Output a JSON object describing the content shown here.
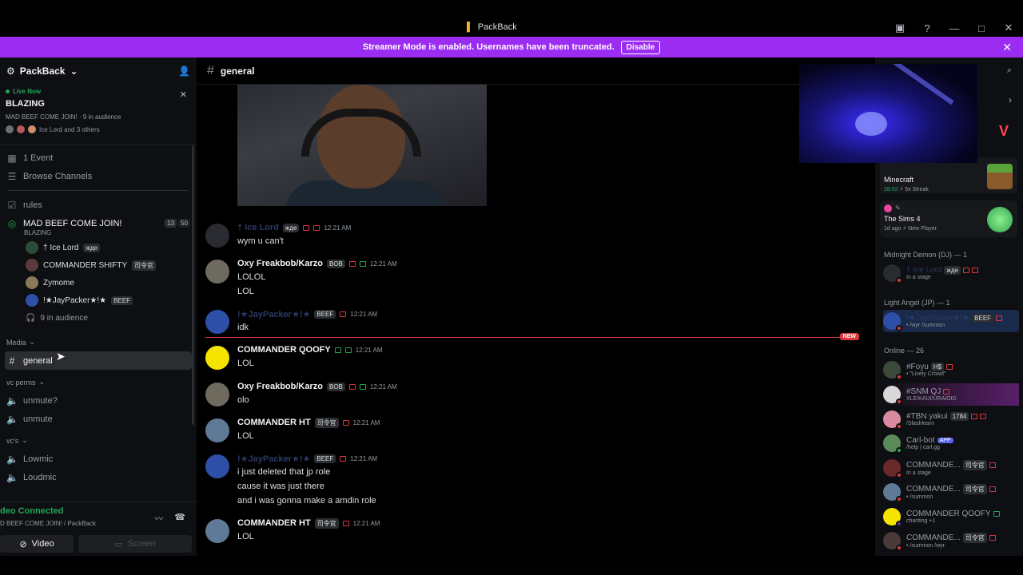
{
  "titlebar": {
    "title": "PackBack"
  },
  "banner": {
    "text": "Streamer Mode is enabled. Usernames have been truncated.",
    "disable_label": "Disable"
  },
  "guild": {
    "name": "PackBack"
  },
  "live": {
    "status": "Live Now",
    "title": "BLAZING",
    "sub": "MAD BEEF COME JOIN! · 9 in audience",
    "users": "Ice Lord and 3 others"
  },
  "channels": {
    "event": "1 Event",
    "browse": "Browse Channels",
    "rules": "rules",
    "stage": {
      "name": "MAD BEEF COME JOIN!",
      "topic": "BLAZING",
      "cam_count": "13",
      "count": "50"
    },
    "stage_users": [
      {
        "name": "† Ice Lord",
        "tag": "жде"
      },
      {
        "name": "COMMANDER SHIFTY",
        "tag": "司令官"
      },
      {
        "name": "Zymome",
        "tag": ""
      },
      {
        "name": "!★JayPacker★!★",
        "tag": "BEEF"
      }
    ],
    "audience": "9 in audience",
    "cat_media": "Media",
    "general": "general",
    "cat_vcperms": "vc perms",
    "unmute_q": "unmute?",
    "unmute": "unmute",
    "cat_vcs": "vc's",
    "lowmic": "Lowmic",
    "loudmic": "Loudmic"
  },
  "voice_panel": {
    "status": "deo Connected",
    "channel": "D BEEF COME JOIN! / PackBack",
    "video_label": "Video",
    "screen_label": "Screen"
  },
  "chat": {
    "channel": "general",
    "messages": [
      {
        "user": "† Ice Lord",
        "hidden": true,
        "tag": "жде",
        "time": "12:21 AM",
        "lines": [
          "wym u can't"
        ]
      },
      {
        "user": "Oxy Freakbob/Karzo",
        "hidden": false,
        "tag": "BOB",
        "time": "12:21 AM",
        "lines": [
          "LOLOL",
          "LOL"
        ]
      },
      {
        "user": "!★JayPacker★!★",
        "hidden": true,
        "tag": "BEEF",
        "time": "12:21 AM",
        "lines": [
          "idk"
        ]
      },
      {
        "user": "COMMANDER QOOFY",
        "hidden": false,
        "tag": "",
        "time": "12:21 AM",
        "lines": [
          "LOL"
        ]
      },
      {
        "user": "Oxy Freakbob/Karzo",
        "hidden": false,
        "tag": "BOB",
        "time": "12:21 AM",
        "lines": [
          "olo"
        ]
      },
      {
        "user": "COMMANDER HT",
        "hidden": false,
        "tag": "司令官",
        "time": "12:21 AM",
        "lines": [
          "LOL"
        ]
      },
      {
        "user": "!★JayPacker★!★",
        "hidden": true,
        "tag": "BEEF",
        "time": "12:21 AM",
        "lines": [
          "i just deleted that jp role",
          "cause it was just there",
          "and i was gonna make a amdin role"
        ]
      },
      {
        "user": "COMMANDER HT",
        "hidden": false,
        "tag": "司令官",
        "time": "12:21 AM",
        "lines": [
          "LOL"
        ]
      }
    ],
    "new_label": "NEW"
  },
  "members": {
    "activities": [
      {
        "title": "Minecraft",
        "time": "28:02",
        "sub": "5x Streak"
      },
      {
        "title": "The Sims 4",
        "time": "1d ago",
        "sub": "New Player"
      }
    ],
    "sec_midnight": "Midnight Demon (DJ) — 1",
    "sec_light": "Light Angel (JP) — 1",
    "sec_online": "Online — 26",
    "midnight_user": {
      "name": "† Ice Lord",
      "tag": "жде",
      "sub": "In a stage"
    },
    "light_user": {
      "name": "!★JayPacker★!★",
      "tag": "BEEF",
      "sub": "• /wyr /summon"
    },
    "online": [
      {
        "name": "#Foyu",
        "tag": "H$",
        "sub": "• \"Lively Crowd\""
      },
      {
        "name": "#SNM QJ",
        "tag": "",
        "sub": "XLE/KAUI/URA/OID"
      },
      {
        "name": "#TBN yakui",
        "tag": "1784",
        "sub": "/Slashlearn"
      },
      {
        "name": "Carl-bot",
        "tag": "APP",
        "sub": "/help | carl.gg"
      },
      {
        "name": "COMMANDE...",
        "tag": "司令官",
        "sub": "In a stage"
      },
      {
        "name": "COMMANDE...",
        "tag": "司令官",
        "sub": "• /summon"
      },
      {
        "name": "COMMANDER QOOFY",
        "tag": "",
        "sub": "chanting +1"
      },
      {
        "name": "COMMANDE...",
        "tag": "司令官",
        "sub": "• /summon /wyr"
      }
    ]
  }
}
